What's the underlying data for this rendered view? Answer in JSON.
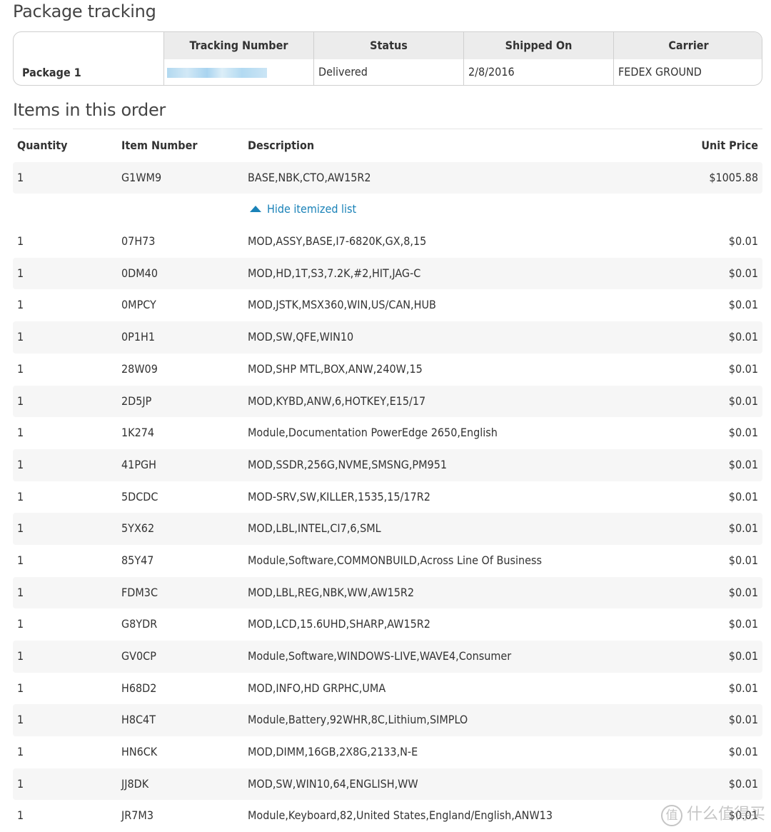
{
  "tracking": {
    "title": "Package tracking",
    "package_label": "Package 1",
    "columns": [
      "Tracking Number",
      "Status",
      "Shipped On",
      "Carrier"
    ],
    "row": {
      "tracking_number": "",
      "status": "Delivered",
      "shipped_on": "2/8/2016",
      "carrier": "FEDEX GROUND"
    }
  },
  "items": {
    "title": "Items in this order",
    "columns": {
      "quantity": "Quantity",
      "item_number": "Item Number",
      "description": "Description",
      "unit_price": "Unit Price"
    },
    "main_item": {
      "quantity": "1",
      "item_number": "G1WM9",
      "description": "BASE,NBK,CTO,AW15R2",
      "unit_price": "$1005.88"
    },
    "toggle_label": "Hide itemized list",
    "sub_items": [
      {
        "quantity": "1",
        "item_number": "07H73",
        "description": "MOD,ASSY,BASE,I7-6820K,GX,8,15",
        "unit_price": "$0.01"
      },
      {
        "quantity": "1",
        "item_number": "0DM40",
        "description": "MOD,HD,1T,S3,7.2K,#2,HIT,JAG-C",
        "unit_price": "$0.01"
      },
      {
        "quantity": "1",
        "item_number": "0MPCY",
        "description": "MOD,JSTK,MSX360,WIN,US/CAN,HUB",
        "unit_price": "$0.01"
      },
      {
        "quantity": "1",
        "item_number": "0P1H1",
        "description": "MOD,SW,QFE,WIN10",
        "unit_price": "$0.01"
      },
      {
        "quantity": "1",
        "item_number": "28W09",
        "description": "MOD,SHP MTL,BOX,ANW,240W,15",
        "unit_price": "$0.01"
      },
      {
        "quantity": "1",
        "item_number": "2D5JP",
        "description": "MOD,KYBD,ANW,6,HOTKEY,E15/17",
        "unit_price": "$0.01"
      },
      {
        "quantity": "1",
        "item_number": "1K274",
        "description": "Module,Documentation PowerEdge 2650,English",
        "unit_price": "$0.01"
      },
      {
        "quantity": "1",
        "item_number": "41PGH",
        "description": "MOD,SSDR,256G,NVME,SMSNG,PM951",
        "unit_price": "$0.01"
      },
      {
        "quantity": "1",
        "item_number": "5DCDC",
        "description": "MOD-SRV,SW,KILLER,1535,15/17R2",
        "unit_price": "$0.01"
      },
      {
        "quantity": "1",
        "item_number": "5YX62",
        "description": "MOD,LBL,INTEL,CI7,6,SML",
        "unit_price": "$0.01"
      },
      {
        "quantity": "1",
        "item_number": "85Y47",
        "description": "Module,Software,COMMONBUILD,Across Line Of Business",
        "unit_price": "$0.01"
      },
      {
        "quantity": "1",
        "item_number": "FDM3C",
        "description": "MOD,LBL,REG,NBK,WW,AW15R2",
        "unit_price": "$0.01"
      },
      {
        "quantity": "1",
        "item_number": "G8YDR",
        "description": "MOD,LCD,15.6UHD,SHARP,AW15R2",
        "unit_price": "$0.01"
      },
      {
        "quantity": "1",
        "item_number": "GV0CP",
        "description": "Module,Software,WINDOWS-LIVE,WAVE4,Consumer",
        "unit_price": "$0.01"
      },
      {
        "quantity": "1",
        "item_number": "H68D2",
        "description": "MOD,INFO,HD GRPHC,UMA",
        "unit_price": "$0.01"
      },
      {
        "quantity": "1",
        "item_number": "H8C4T",
        "description": "Module,Battery,92WHR,8C,Lithium,SIMPLO",
        "unit_price": "$0.01"
      },
      {
        "quantity": "1",
        "item_number": "HN6CK",
        "description": "MOD,DIMM,16GB,2X8G,2133,N-E",
        "unit_price": "$0.01"
      },
      {
        "quantity": "1",
        "item_number": "JJ8DK",
        "description": "MOD,SW,WIN10,64,ENGLISH,WW",
        "unit_price": "$0.01"
      },
      {
        "quantity": "1",
        "item_number": "JR7M3",
        "description": "Module,Keyboard,82,United States,England/English,ANW13",
        "unit_price": "$0.01"
      }
    ]
  },
  "watermark": {
    "badge": "值",
    "text": "什么值得买"
  },
  "colors": {
    "link": "#1a82b8",
    "header_bg": "#ececec",
    "row_alt_bg": "#f6f6f6"
  }
}
